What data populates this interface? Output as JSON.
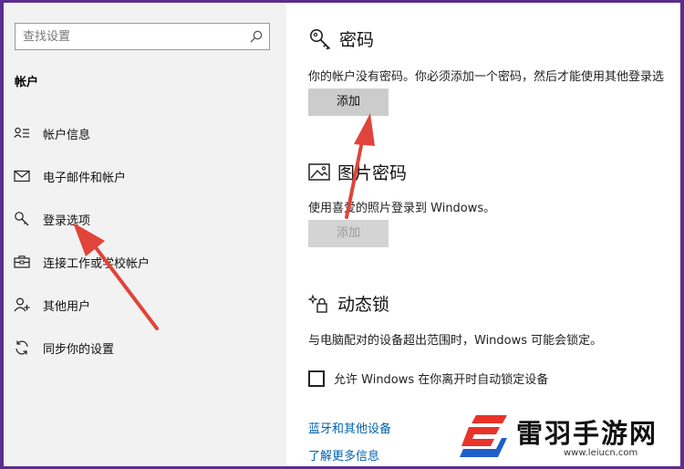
{
  "sidebar": {
    "search": {
      "placeholder": "查找设置"
    },
    "section_title": "帐户",
    "items": [
      {
        "label": "帐户信息",
        "icon": "account-info-icon"
      },
      {
        "label": "电子邮件和帐户",
        "icon": "mail-icon"
      },
      {
        "label": "登录选项",
        "icon": "key-icon"
      },
      {
        "label": "连接工作或学校帐户",
        "icon": "briefcase-icon"
      },
      {
        "label": "其他用户",
        "icon": "person-add-icon"
      },
      {
        "label": "同步你的设置",
        "icon": "sync-icon"
      }
    ]
  },
  "main": {
    "password": {
      "title": "密码",
      "description": "你的帐户没有密码。你必须添加一个密码，然后才能使用其他登录选",
      "button": "添加"
    },
    "picture_password": {
      "title": "图片密码",
      "description": "使用喜爱的照片登录到 Windows。",
      "button": "添加"
    },
    "dynamic_lock": {
      "title": "动态锁",
      "description": "与电脑配对的设备超出范围时，Windows 可能会锁定。",
      "checkbox_label": "允许 Windows 在你离开时自动锁定设备"
    },
    "links": {
      "bluetooth": "蓝牙和其他设备",
      "learn_more": "了解更多信息"
    }
  },
  "watermark": {
    "title": "雷羽手游网",
    "url": "www.leiucn.com"
  },
  "colors": {
    "frame": "#5b2d8e",
    "sidebar_bg": "#f2f2f2",
    "link": "#0063b1",
    "button_bg": "#cccccc",
    "arrow": "#e0443a",
    "logo_red": "#e8332a",
    "logo_blue": "#1e5fc9"
  }
}
